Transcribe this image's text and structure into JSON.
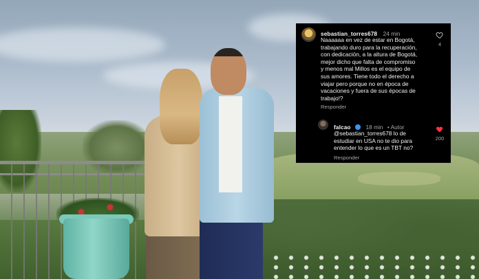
{
  "comments": [
    {
      "username": "sebastian_torres678",
      "time": "24 min",
      "text_lines": [
        "Naaaaaa en vez de estar en Bogotá,",
        "trabajando duro para la recuperación,",
        "con dedicación, a la altura de Bogotá,",
        "mejor dicho que falta de compromiso",
        "y menos mal Millos es el equipo de",
        "sus amores. Tiene todo el derecho a",
        "viajar pero porque no en época de",
        "vacaciones y fuera de sus épocas de",
        "trabajo!?"
      ],
      "reply_label": "Responder",
      "likes": "4",
      "like_icon": "heart-outline-icon",
      "liked": false
    },
    {
      "username": "falcao",
      "verified_icon": "verified-badge-icon",
      "time": "18 min",
      "author_tag": "• Autor",
      "text_lines": [
        "@sebastian_torres678 lo de",
        "estudiar en USA no te dio para",
        "entender lo que es un TBT no?"
      ],
      "reply_label": "Responder",
      "likes": "200",
      "like_icon": "heart-filled-icon",
      "liked": true,
      "like_color": "#ff3040"
    }
  ]
}
